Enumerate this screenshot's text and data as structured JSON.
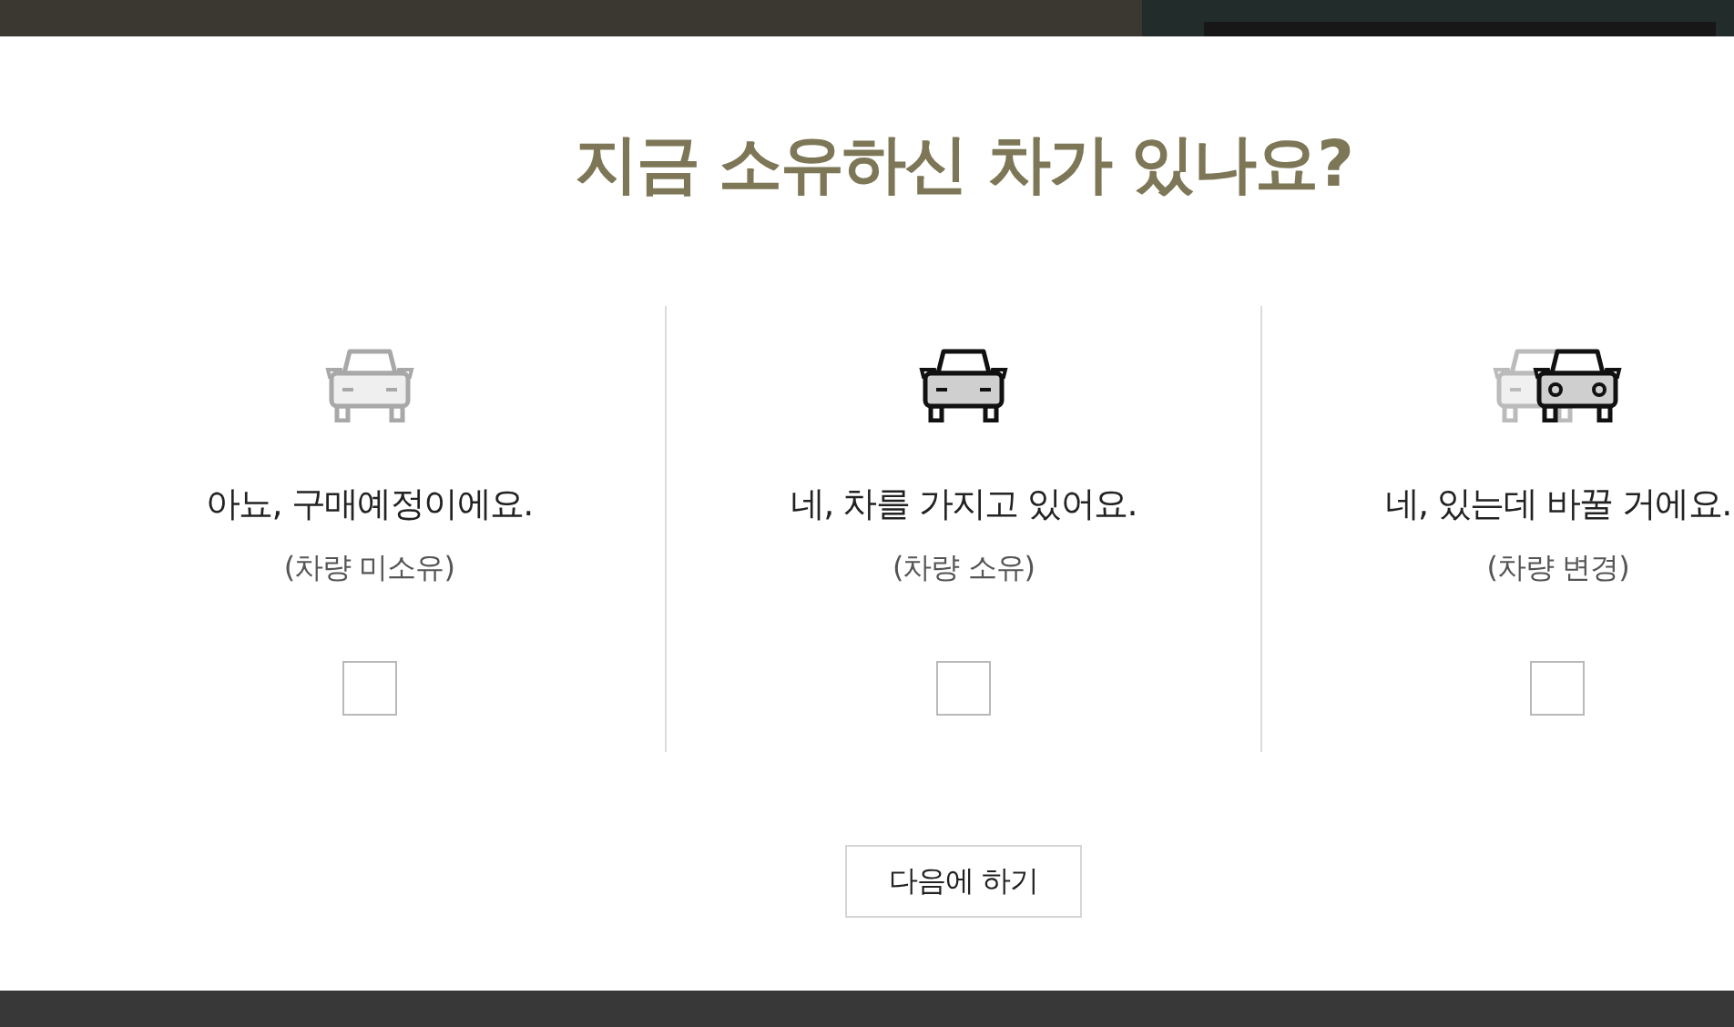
{
  "title": "지금 소유하신 차가 있나요?",
  "options": [
    {
      "kind": "none",
      "label": "아뇨, 구매예정이에요.",
      "sub": "(차량 미소유)",
      "checked": false
    },
    {
      "kind": "own",
      "label": "네, 차를 가지고 있어요.",
      "sub": "(차량 소유)",
      "checked": false
    },
    {
      "kind": "change",
      "label": "네, 있는데 바꿀 거에요.",
      "sub": "(차량 변경)",
      "checked": false
    }
  ],
  "button": "다음에 하기"
}
